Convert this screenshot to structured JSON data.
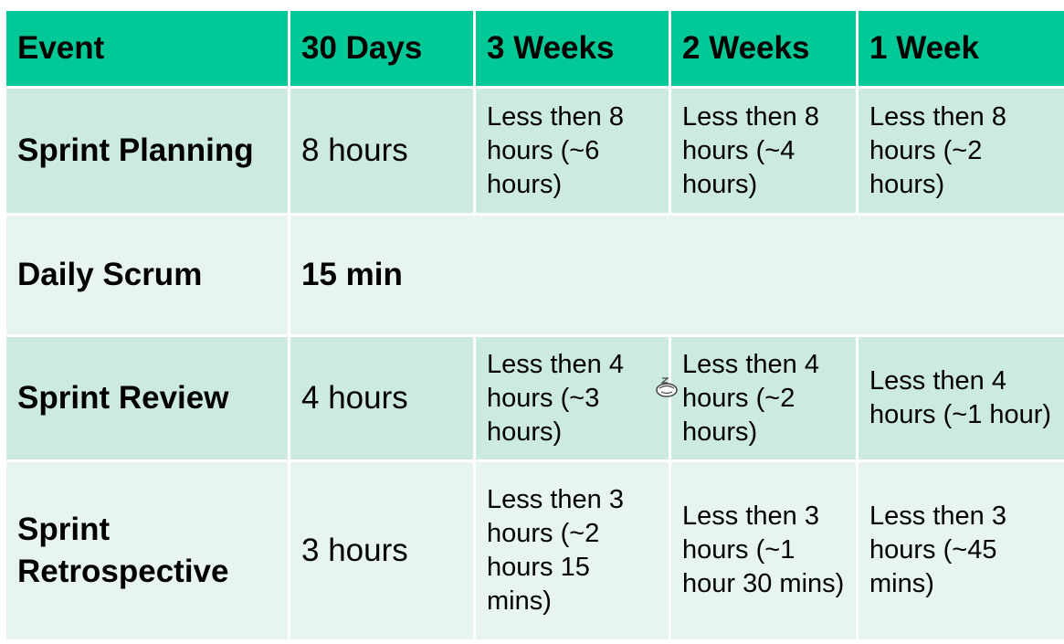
{
  "table": {
    "headers": [
      "Event",
      "30 Days",
      "3 Weeks",
      "2 Weeks",
      "1 Week"
    ],
    "rows": {
      "planning": {
        "event": "Sprint Planning",
        "d30": "8 hours",
        "w3": "Less then 8 hours (~6 hours)",
        "w2": "Less then 8 hours (~4 hours)",
        "w1": "Less then 8 hours (~2 hours)"
      },
      "daily": {
        "event": "Daily Scrum",
        "all": "15 min"
      },
      "review": {
        "event": "Sprint Review",
        "d30": "4 hours",
        "w3": "Less then 4 hours (~3 hours)",
        "w2": "Less then 4 hours (~2 hours)",
        "w1": "Less then 4 hours (~1 hour)"
      },
      "retro": {
        "event": "Sprint Retrospective",
        "d30": "3 hours",
        "w3": "Less then 3 hours (~2 hours 15 mins)",
        "w2": "Less then 3 hours (~1 hour 30 mins)",
        "w1": "Less then 3 hours (~45 mins)"
      }
    }
  },
  "colors": {
    "header_bg": "#00c896",
    "row_dark": "#cceadd",
    "row_light": "#e7f5ee",
    "highlight": "#e30000"
  },
  "icons": {
    "cursor": "busy-cursor-icon"
  }
}
